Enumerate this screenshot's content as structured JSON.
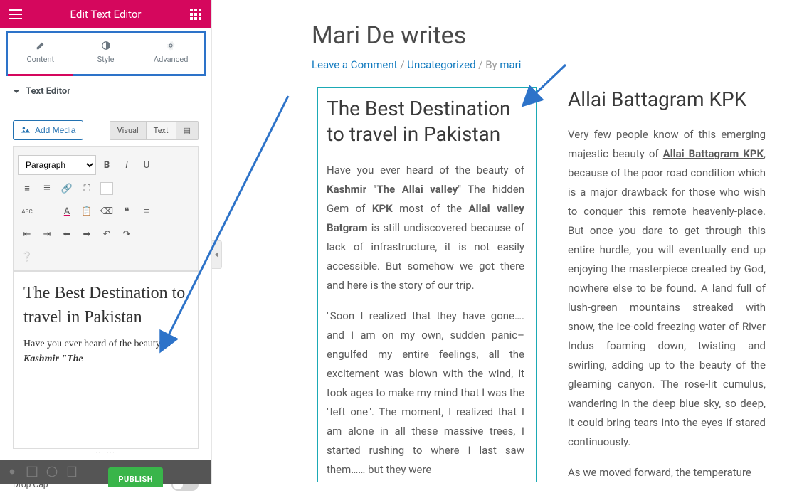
{
  "editor": {
    "header_title": "Edit Text Editor",
    "tabs": {
      "content": "Content",
      "style": "Style",
      "advanced": "Advanced"
    },
    "section_label": "Text Editor",
    "add_media_label": "Add Media",
    "view_tabs": {
      "visual": "Visual",
      "text": "Text"
    },
    "format_select": "Paragraph",
    "dropcap_label": "Drop Cap",
    "publish_label": "PUBLISH"
  },
  "editor_content": {
    "heading": "The Best Destination to travel in Pakistan",
    "body_prefix": "Have you ever heard of the beauty of ",
    "body_italic": "Kashmir \"The"
  },
  "post": {
    "title": "Mari De writes",
    "meta_leave": "Leave a Comment",
    "meta_cat": "Uncategorized",
    "meta_by": " / By ",
    "meta_author": "mari",
    "sep": " / "
  },
  "left_col": {
    "heading": "The Best Destination to travel in Pakistan",
    "p1_a": "Have you ever heard of the beauty of ",
    "p1_kashmir": "Kashmir \"The Allai valley",
    "p1_b": "\" The hidden Gem of ",
    "p1_kpk": "KPK",
    "p1_c": " most of the ",
    "p1_allai": "Allai valley Batgram",
    "p1_d": " is still undiscovered because of lack of infrastructure, it is not easily accessible. But somehow we got there and here is the story of our trip.",
    "p2": "\"Soon I realized that they have gone…. and I am on my own, sudden panic–engulfed my entire feelings, all the excitement was blown with the wind, it took ages to make my mind that I was the \"left one\". The moment, I realized that I am alone in all these massive trees, I started rushing to where I last saw them…… but they were"
  },
  "right_col": {
    "heading": "Allai Battagram KPK",
    "p1_a": "Very few people know of this emerging majestic beauty of ",
    "p1_link": "Allai Battagram KPK",
    "p1_b": ", because of the poor road condition which is a major drawback for those who wish to conquer this remote heavenly-place. But once you dare to get through this entire hurdle, you will eventually end up enjoying the masterpiece created by God, nowhere else to be found. A land full of lush-green mountains streaked with snow, the ice-cold freezing water of River Indus foaming down, twisting and swirling, adding up to the beauty of the gleaming canyon. The rose-lit cumulus, wandering in the deep blue sky, so deep, it could bring tears into the eyes if stared continuously.",
    "p2": "  As we moved forward, the temperature"
  }
}
